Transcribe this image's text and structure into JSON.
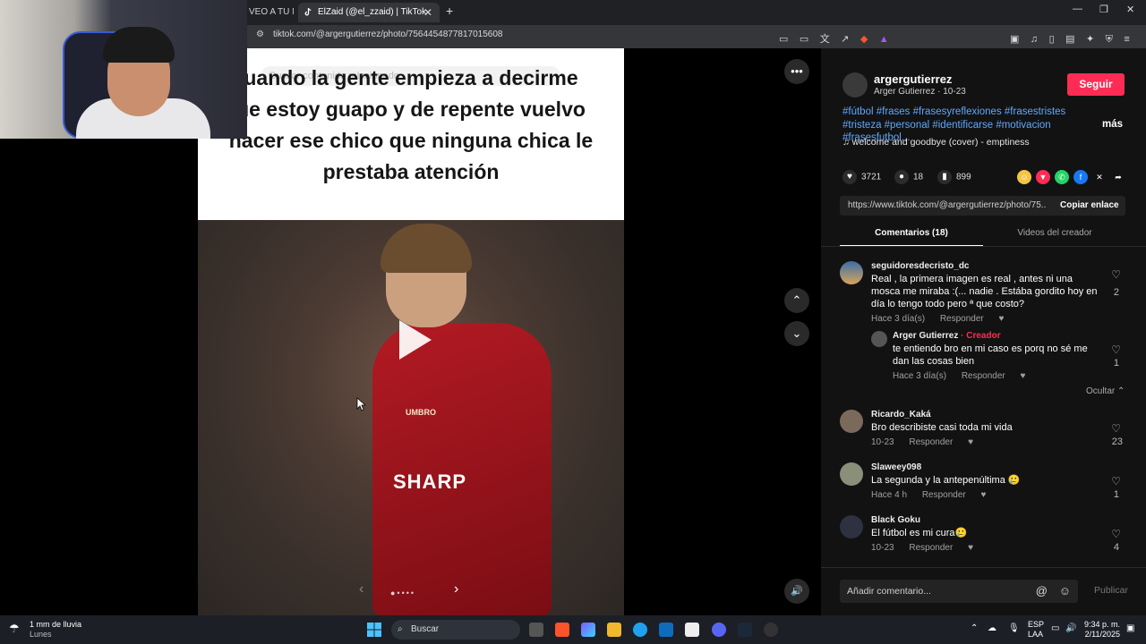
{
  "browser": {
    "tab_partial": "VEO A TU M",
    "active_tab": "ElZaid (@el_zzaid) | TikTok",
    "new_tab": "+",
    "url": "tiktok.com/@argergutierrez/photo/7564454877817015608",
    "window_controls": [
      "—",
      "❐",
      "✕"
    ]
  },
  "post": {
    "search_ghost": "Buscar contenido relacionado",
    "caption": "uando la gente empieza a decirme\nue estoy guapo y de repente vuelvo\nhacer ese chico que ninguna chica le\nprestaba atención",
    "jersey_sponsor": "SHARP",
    "jersey_brand": "UMBRO",
    "more_label": "•••",
    "up_label": "⌃",
    "down_label": "⌄",
    "volume_label": "🔊"
  },
  "creator": {
    "username": "argergutierrez",
    "display_and_date": "Arger Gutierrez · 10-23",
    "follow_label": "Seguir",
    "hashtags": "#fútbol #frases #frasesyreflexiones #frasestristes #tristeza #personal #identificarse #motivacion #frasesfutbol...",
    "more_label": "más",
    "music": "welcome and goodbye (cover) - emptiness"
  },
  "stats": {
    "likes": "3721",
    "comments": "18",
    "saves": "899"
  },
  "share_link": {
    "url": "https://www.tiktok.com/@argergutierrez/photo/75...",
    "copy_label": "Copiar enlace"
  },
  "tabs": {
    "comments": "Comentarios (18)",
    "creator_videos": "Videos del creador"
  },
  "comments": [
    {
      "user": "seguidoresdecristo_dc",
      "text": "Real , la primera imagen es real , antes ni una mosca me miraba :(... nadie . Estába gordito hoy en día lo tengo todo pero ª que costo?",
      "time": "Hace 3 día(s)",
      "reply": "Responder",
      "likes": "2"
    },
    {
      "user": "Arger Gutierrez",
      "badge": "· Creador",
      "text": "te entiendo bro en mi caso es porq no sé me dan las cosas bien",
      "time": "Hace 3 día(s)",
      "reply": "Responder",
      "likes": "1"
    },
    {
      "user": "Ricardo_Kaká",
      "text": "Bro describiste casi toda mi vida",
      "time": "10-23",
      "reply": "Responder",
      "likes": "23"
    },
    {
      "user": "Slaweey098",
      "text": "La segunda y la antepenúltima 🥲",
      "time": "Hace 4 h",
      "reply": "Responder",
      "likes": "1"
    },
    {
      "user": "Black Goku",
      "text": "El fútbol es mi cura🥲",
      "time": "10-23",
      "reply": "Responder",
      "likes": "4"
    }
  ],
  "hide_label": "Ocultar",
  "composer": {
    "placeholder": "Añadir comentario...",
    "publish": "Publicar"
  },
  "taskbar": {
    "weather": "1 mm de lluvia",
    "weather_day": "Lunes",
    "search": "Buscar",
    "lang1": "ESP",
    "lang2": "LAA",
    "time": "9:34 p. m.",
    "date": "2/11/2025"
  },
  "colors": {
    "accent": "#fe2c55",
    "hashtag": "#5ea8ff",
    "panel_bg": "#121212"
  }
}
